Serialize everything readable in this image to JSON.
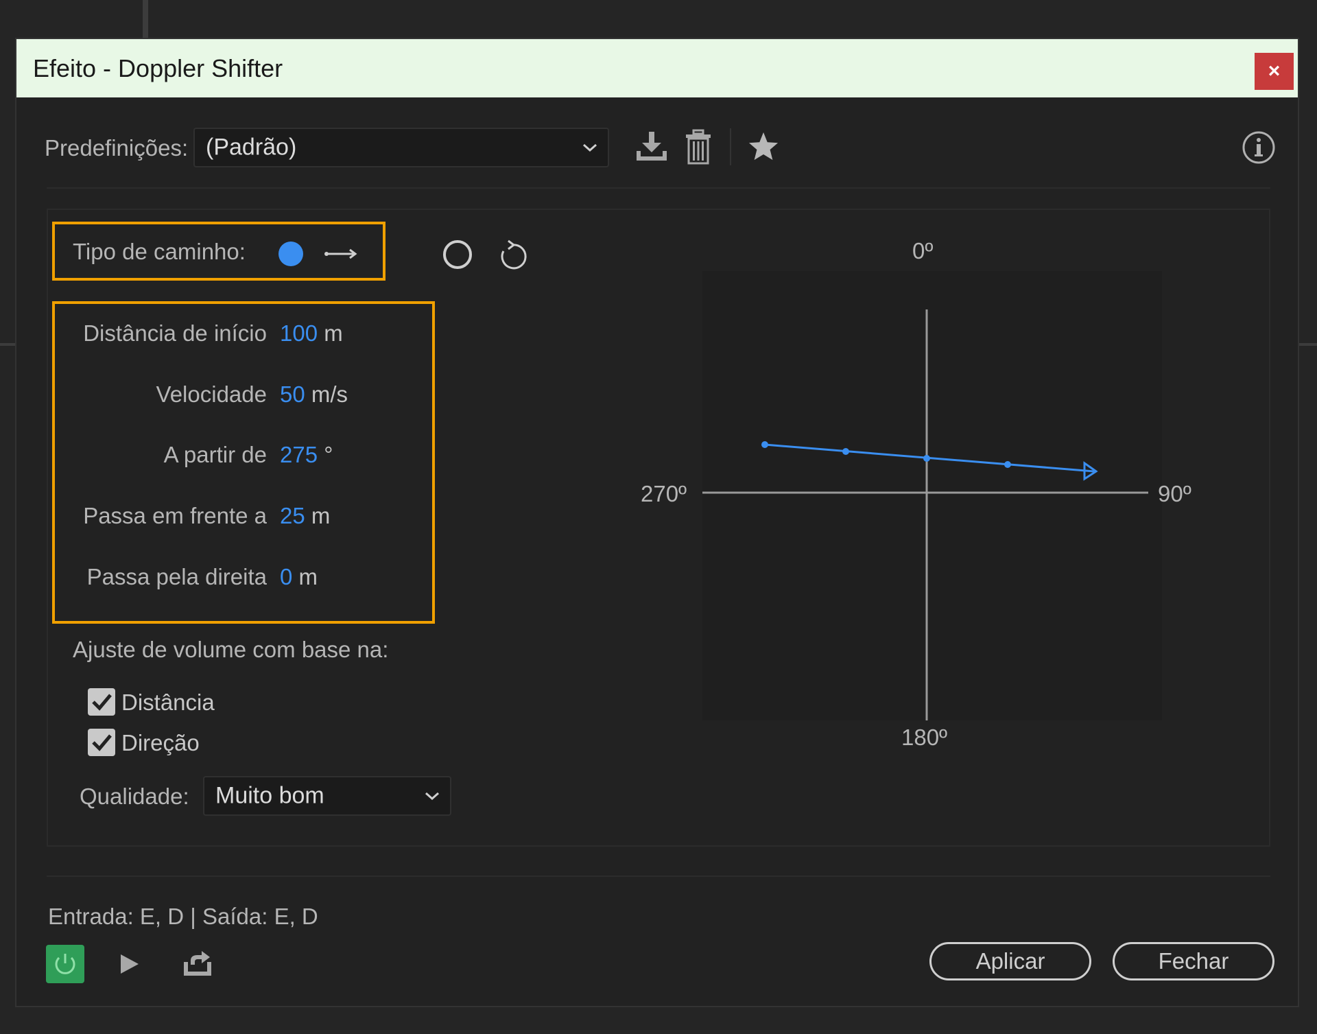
{
  "window": {
    "title": "Efeito - Doppler Shifter",
    "close_label": "×"
  },
  "presets": {
    "label": "Predefinições:",
    "value": "(Padrão)"
  },
  "path_type": {
    "label": "Tipo de caminho:"
  },
  "params": [
    {
      "label": "Distância de início",
      "value": "100",
      "unit": "m"
    },
    {
      "label": "Velocidade",
      "value": "50",
      "unit": "m/s"
    },
    {
      "label": "A partir de",
      "value": "275",
      "unit": "°"
    },
    {
      "label": "Passa em frente a",
      "value": "25",
      "unit": "m"
    },
    {
      "label": "Passa pela direita",
      "value": "0",
      "unit": "m"
    }
  ],
  "volume": {
    "label": "Ajuste de volume com base na:",
    "options": [
      {
        "label": "Distância",
        "checked": true
      },
      {
        "label": "Direção",
        "checked": true
      }
    ]
  },
  "quality": {
    "label": "Qualidade:",
    "value": "Muito bom"
  },
  "graph": {
    "label_top": "0º",
    "label_right": "90º",
    "label_bottom": "180º",
    "label_left": "270º"
  },
  "footer": {
    "io_text": "Entrada: E, D | Saída: E, D",
    "apply_label": "Aplicar",
    "close_label": "Fechar"
  },
  "colors": {
    "accent": "#3a8ef0",
    "highlight": "#f0a000",
    "power": "#2f9e58",
    "close": "#c73b3b"
  }
}
